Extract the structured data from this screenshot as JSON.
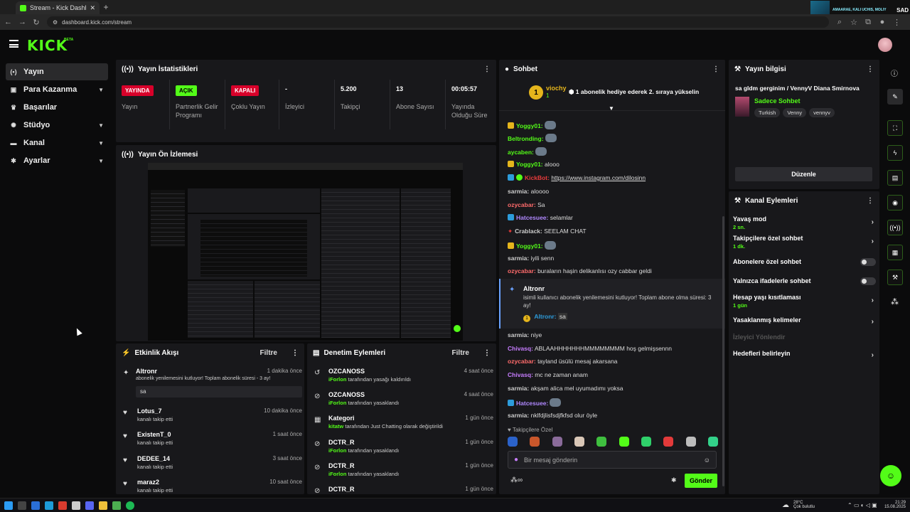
{
  "browser": {
    "tab_title": "Stream - Kick Dashboard",
    "url": "dashboard.kick.com/stream",
    "media_title": "AMAARAE, KALI UCHIS, MOLIY",
    "media_side": "SAD"
  },
  "app": {
    "logo": "KICK",
    "beta": "BETA"
  },
  "sidebar": {
    "items": [
      {
        "label": "Yayın",
        "icon": "((•))"
      },
      {
        "label": "Para Kazanma",
        "icon": "$"
      },
      {
        "label": "Başarılar",
        "icon": "🏆"
      },
      {
        "label": "Stüdyo",
        "icon": "⚙"
      },
      {
        "label": "Kanal",
        "icon": "▤"
      },
      {
        "label": "Ayarlar",
        "icon": "⚙"
      }
    ]
  },
  "stats": {
    "title": "Yayın İstatistikleri",
    "items": [
      {
        "value": "YAYINDA",
        "label": "Yayın"
      },
      {
        "value": "AÇIK",
        "label": "Partnerlik Gelir Programı"
      },
      {
        "value": "KAPALI",
        "label": "Çoklu Yayın"
      },
      {
        "value": "-",
        "label": "İzleyici"
      },
      {
        "value": "5.200",
        "label": "Takipçi"
      },
      {
        "value": "13",
        "label": "Abone Sayısı"
      },
      {
        "value": "00:05:57",
        "label": "Yayında Olduğu Süre"
      }
    ]
  },
  "preview": {
    "title": "Yayın Ön İzlemesi"
  },
  "activity": {
    "title": "Etkinlik Akışı",
    "filter": "Filtre",
    "items": [
      {
        "user": "Altronr",
        "time": "1 dakika önce",
        "desc": "abonelik yenilemesini kutluyor! Toplam abonelik süresi - 3 ay!",
        "msg": "sa"
      },
      {
        "user": "Lotus_7",
        "time": "10 dakika önce",
        "desc": "kanalı takip etti"
      },
      {
        "user": "ExistenT_0",
        "time": "1 saat önce",
        "desc": "kanalı takip etti"
      },
      {
        "user": "DEDEE_14",
        "time": "3 saat önce",
        "desc": "kanalı takip etti"
      },
      {
        "user": "maraz2",
        "time": "10 saat önce",
        "desc": "kanalı takip etti"
      }
    ]
  },
  "moderation": {
    "title": "Denetim Eylemleri",
    "filter": "Filtre",
    "items": [
      {
        "user": "OZCANOSS",
        "time": "4 saat önce",
        "by": "iForlon",
        "desc": "tarafından yasağı kaldırıldı"
      },
      {
        "user": "OZCANOSS",
        "time": "4 saat önce",
        "by": "iForlon",
        "desc": "tarafından yasaklandı"
      },
      {
        "user": "Kategori",
        "time": "1 gün önce",
        "by": "kitatw",
        "desc": "tarafından Just Chatting olarak değiştirildi"
      },
      {
        "user": "DCTR_R",
        "time": "1 gün önce",
        "by": "iForlon",
        "desc": "tarafından yasaklandı"
      },
      {
        "user": "DCTR_R",
        "time": "1 gün önce",
        "by": "iForlon",
        "desc": "tarafından yasaklandı"
      },
      {
        "user": "DCTR_R",
        "time": "1 gün önce",
        "by": "",
        "desc": ""
      }
    ]
  },
  "chat": {
    "title": "Sohbet",
    "pinned_user": "viochy",
    "pinned_count": "1",
    "pinned_rank": "1",
    "pinned_text": "1 abonelik hediye ederek 2. sıraya yükselin",
    "messages": [
      {
        "user": "Yoggy01:",
        "text": "",
        "color": "#53fc18",
        "badge": "#e5b51c"
      },
      {
        "user": "Beltronding:",
        "text": "",
        "color": "#53fc18",
        "badge": ""
      },
      {
        "user": "aycaben:",
        "text": "",
        "color": "#53fc18",
        "badge": ""
      },
      {
        "user": "Yoggy01:",
        "text": "alooo",
        "color": "#53fc18",
        "badge": "#e5b51c"
      },
      {
        "user": "KickBot:",
        "text": "https://www.instagram.com/dilosinn",
        "color": "#e93b3b",
        "badge": "#2d9cdb"
      },
      {
        "user": "sarmia:",
        "text": "aloooo",
        "color": "#cccccc",
        "badge": ""
      },
      {
        "user": "ozycabar:",
        "text": "Sa",
        "color": "#ff6b6b",
        "badge": ""
      },
      {
        "user": "Hatcesuee:",
        "text": "selamlar",
        "color": "#b088ff",
        "badge": "#2d9cdb"
      },
      {
        "user": "Crablack:",
        "text": "SEELAM CHAT",
        "color": "#cccccc",
        "badge": ""
      },
      {
        "user": "Yoggy01:",
        "text": "",
        "color": "#53fc18",
        "badge": "#e5b51c"
      },
      {
        "user": "sarmia:",
        "text": "iyili senn",
        "color": "#cccccc",
        "badge": ""
      },
      {
        "user": "ozycabar:",
        "text": "buraların haşin delikanlısı ozy cabbar geldi",
        "color": "#ff6b6b",
        "badge": ""
      }
    ],
    "sub_alert": {
      "user": "Altronr",
      "text": "isimli kullanıcı abonelik yenilemesini kutluyor! Toplam abone olma süresi: 3 ay!",
      "reply_user": "Altronr:",
      "reply_text": "sa",
      "reply_count": "1"
    },
    "messages2": [
      {
        "user": "sarmia:",
        "text": "niye",
        "color": "#cccccc"
      },
      {
        "user": "Chivasq:",
        "text": "ABLAAHHHHHHHMMMMMMMM hoş gelmişsennn",
        "color": "#c77dff"
      },
      {
        "user": "ozycabar:",
        "text": "tayland üsülü mesaj akarsana",
        "color": "#ff6b6b"
      },
      {
        "user": "Chivasq:",
        "text": "mc ne zaman anam",
        "color": "#c77dff"
      },
      {
        "user": "sarmia:",
        "text": "akşam alica mel uyumadımı yoksa",
        "color": "#cccccc"
      },
      {
        "user": "Hatcesuee:",
        "text": "",
        "color": "#b088ff"
      },
      {
        "user": "sarmia:",
        "text": "nklfdjlisfsdjfkfsd olur öyle",
        "color": "#cccccc"
      }
    ],
    "followers_label": "Takipçilere Özel",
    "input_placeholder": "Bir mesaj gönderin",
    "send": "Gönder"
  },
  "info": {
    "title": "Yayın bilgisi",
    "stream_title": "sa gldm gerginim / VennyV Diana Smirnova",
    "category": "Sadece Sohbet",
    "tags": [
      "Turkish",
      "Venny",
      "vennyv"
    ],
    "edit": "Düzenle"
  },
  "channel": {
    "title": "Kanal Eylemleri",
    "items": [
      {
        "label": "Yavaş mod",
        "sub": "2 sn.",
        "kind": "arrow"
      },
      {
        "label": "Takipçilere özel sohbet",
        "sub": "1 dk.",
        "kind": "arrow"
      },
      {
        "label": "Abonelere özel sohbet",
        "sub": "",
        "kind": "toggle"
      },
      {
        "label": "Yalnızca ifadelerle sohbet",
        "sub": "",
        "kind": "toggle"
      },
      {
        "label": "Hesap yaşı kısıtlaması",
        "sub": "1 gün",
        "kind": "arrow"
      },
      {
        "label": "Yasaklanmış kelimeler",
        "sub": "",
        "kind": "arrow"
      },
      {
        "label": "İzleyici Yönlendir",
        "sub": "",
        "kind": "disabled"
      },
      {
        "label": "Hedefleri belirleyin",
        "sub": "",
        "kind": "arrow"
      }
    ]
  },
  "taskbar": {
    "weather_temp": "28°C",
    "weather_desc": "Çok bulutlu",
    "time": "21:29",
    "date": "15.08.2025"
  },
  "colors": {
    "accent": "#53fc18",
    "live": "#d8002a",
    "panel": "#18181b"
  }
}
